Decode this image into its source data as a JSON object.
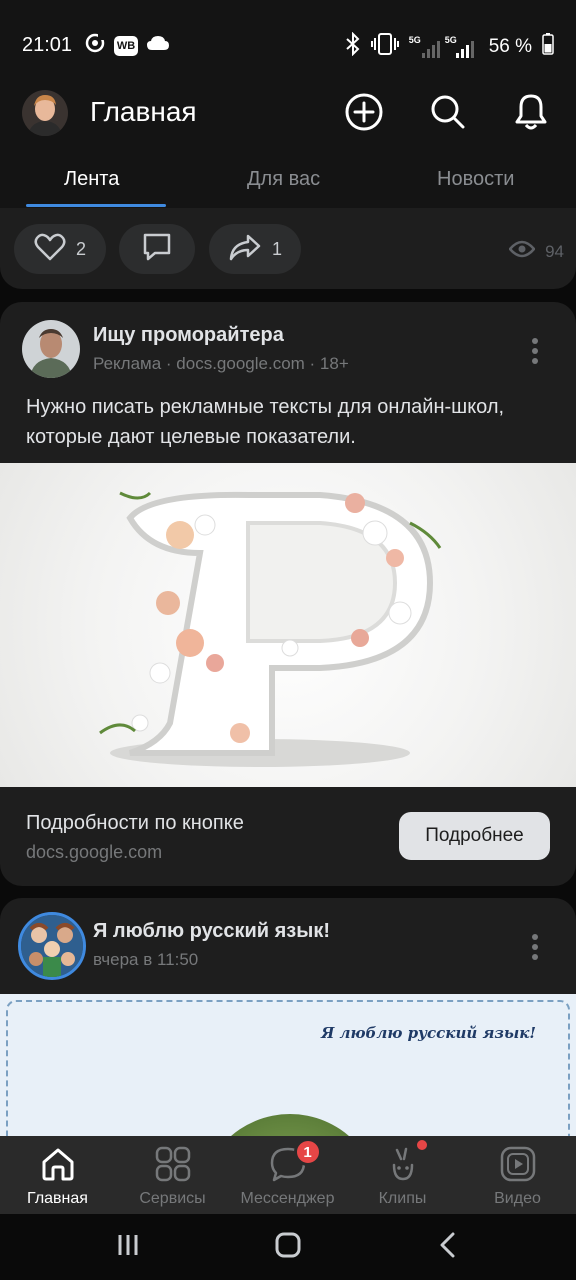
{
  "status_bar": {
    "time": "21:01",
    "battery_text": "56 %",
    "network_a": "5G",
    "network_b": "5G",
    "wb_label": "WB",
    "icons": [
      "podcast-icon",
      "wb-icon",
      "cloud-icon",
      "bluetooth-icon",
      "vibrate-icon",
      "signal-icon",
      "battery-icon"
    ]
  },
  "header": {
    "title": "Главная",
    "icons": [
      "add-icon",
      "search-icon",
      "bell-icon"
    ]
  },
  "tabs": [
    {
      "label": "Лента",
      "active": true
    },
    {
      "label": "Для вас",
      "active": false
    },
    {
      "label": "Новости",
      "active": false
    }
  ],
  "prev_post_actions": {
    "likes": "2",
    "shares": "1",
    "views": "94"
  },
  "ad_post": {
    "author": "Ищу проморайтера",
    "meta": "Реклама · docs.google.com · 18+",
    "text": "Нужно писать рекламные тексты для онлайн-школ, которые дают целевые показатели.",
    "image_letter": "P",
    "footer_title": "Подробности по кнопке",
    "footer_sub": "docs.google.com",
    "button_label": "Подробнее"
  },
  "group_post": {
    "author": "Я люблю русский язык!",
    "meta": "вчера в 11:50",
    "banner_text": "Я люблю русский язык!"
  },
  "bottom_nav": [
    {
      "label": "Главная",
      "icon": "home-icon",
      "active": true
    },
    {
      "label": "Сервисы",
      "icon": "services-icon",
      "active": false
    },
    {
      "label": "Мессенджер",
      "icon": "messenger-icon",
      "active": false,
      "badge": "1"
    },
    {
      "label": "Клипы",
      "icon": "clips-icon",
      "active": false
    },
    {
      "label": "Видео",
      "icon": "video-icon",
      "active": false
    }
  ],
  "colors": {
    "accent": "#3f8ae0",
    "badge": "#e64646",
    "card": "#1e1e1e"
  }
}
